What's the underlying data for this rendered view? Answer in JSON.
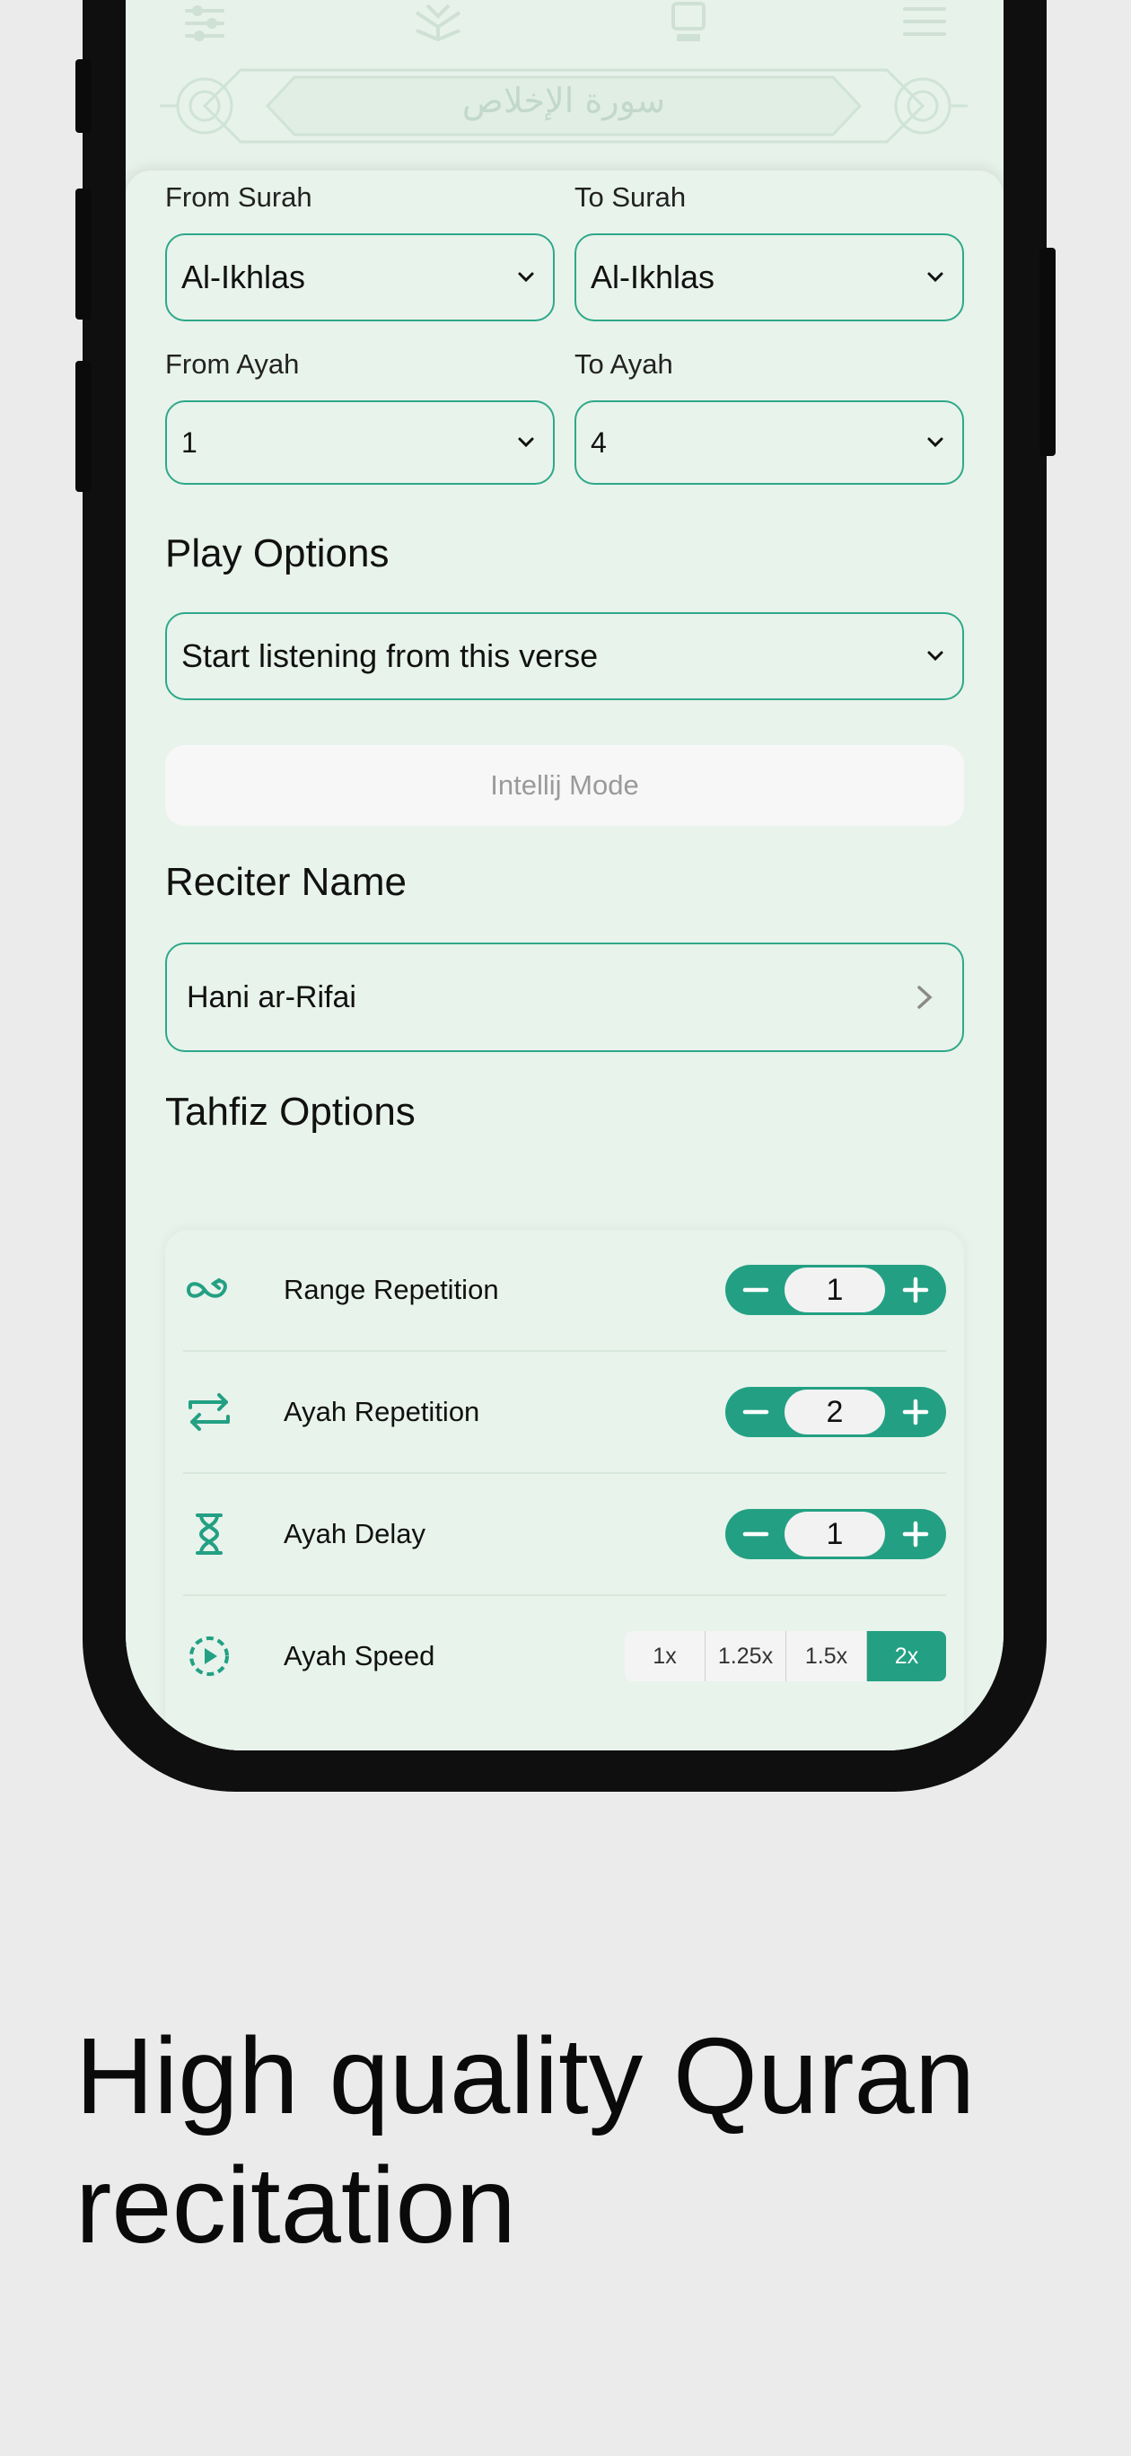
{
  "header": {
    "surah_banner_arabic": "سورة الإخلاص",
    "icons": [
      "sliders-icon",
      "quran-icon",
      "tafsir-icon",
      "menu-icon"
    ]
  },
  "range": {
    "from_surah_label": "From Surah",
    "from_surah_value": "Al-Ikhlas",
    "to_surah_label": "To Surah",
    "to_surah_value": "Al-Ikhlas",
    "from_ayah_label": "From Ayah",
    "from_ayah_value": "1",
    "to_ayah_label": "To Ayah",
    "to_ayah_value": "4"
  },
  "play_options": {
    "heading": "Play Options",
    "value": "Start listening from this verse",
    "intellij_button": "Intellij Mode"
  },
  "reciter": {
    "heading": "Reciter Name",
    "value": "Hani ar-Rifai"
  },
  "tahfiz": {
    "heading": "Tahfiz Options",
    "rows": [
      {
        "label": "Range Repetition",
        "value": "1",
        "icon": "infinity-repeat-icon"
      },
      {
        "label": "Ayah Repetition",
        "value": "2",
        "icon": "repeat-arrows-icon"
      },
      {
        "label": "Ayah Delay",
        "value": "1",
        "icon": "hourglass-icon"
      }
    ],
    "speed": {
      "label": "Ayah Speed",
      "icon": "speed-play-icon",
      "options": [
        "1x",
        "1.25x",
        "1.5x",
        "2x"
      ],
      "selected": "2x"
    }
  },
  "caption": "High quality Quran recitation",
  "colors": {
    "accent": "#23a083",
    "border": "#2ea889",
    "sheet": "#e8f3eb",
    "background": "#ebebeb"
  }
}
